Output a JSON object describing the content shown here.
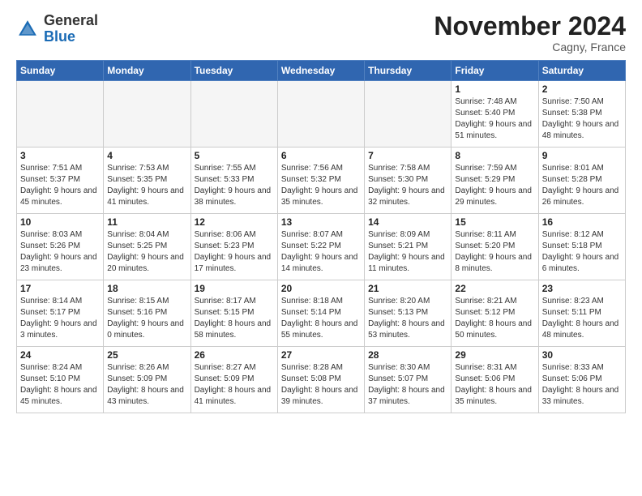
{
  "logo": {
    "general": "General",
    "blue": "Blue"
  },
  "header": {
    "title": "November 2024",
    "location": "Cagny, France"
  },
  "weekdays": [
    "Sunday",
    "Monday",
    "Tuesday",
    "Wednesday",
    "Thursday",
    "Friday",
    "Saturday"
  ],
  "weeks": [
    [
      {
        "day": "",
        "info": ""
      },
      {
        "day": "",
        "info": ""
      },
      {
        "day": "",
        "info": ""
      },
      {
        "day": "",
        "info": ""
      },
      {
        "day": "",
        "info": ""
      },
      {
        "day": "1",
        "info": "Sunrise: 7:48 AM\nSunset: 5:40 PM\nDaylight: 9 hours and 51 minutes."
      },
      {
        "day": "2",
        "info": "Sunrise: 7:50 AM\nSunset: 5:38 PM\nDaylight: 9 hours and 48 minutes."
      }
    ],
    [
      {
        "day": "3",
        "info": "Sunrise: 7:51 AM\nSunset: 5:37 PM\nDaylight: 9 hours and 45 minutes."
      },
      {
        "day": "4",
        "info": "Sunrise: 7:53 AM\nSunset: 5:35 PM\nDaylight: 9 hours and 41 minutes."
      },
      {
        "day": "5",
        "info": "Sunrise: 7:55 AM\nSunset: 5:33 PM\nDaylight: 9 hours and 38 minutes."
      },
      {
        "day": "6",
        "info": "Sunrise: 7:56 AM\nSunset: 5:32 PM\nDaylight: 9 hours and 35 minutes."
      },
      {
        "day": "7",
        "info": "Sunrise: 7:58 AM\nSunset: 5:30 PM\nDaylight: 9 hours and 32 minutes."
      },
      {
        "day": "8",
        "info": "Sunrise: 7:59 AM\nSunset: 5:29 PM\nDaylight: 9 hours and 29 minutes."
      },
      {
        "day": "9",
        "info": "Sunrise: 8:01 AM\nSunset: 5:28 PM\nDaylight: 9 hours and 26 minutes."
      }
    ],
    [
      {
        "day": "10",
        "info": "Sunrise: 8:03 AM\nSunset: 5:26 PM\nDaylight: 9 hours and 23 minutes."
      },
      {
        "day": "11",
        "info": "Sunrise: 8:04 AM\nSunset: 5:25 PM\nDaylight: 9 hours and 20 minutes."
      },
      {
        "day": "12",
        "info": "Sunrise: 8:06 AM\nSunset: 5:23 PM\nDaylight: 9 hours and 17 minutes."
      },
      {
        "day": "13",
        "info": "Sunrise: 8:07 AM\nSunset: 5:22 PM\nDaylight: 9 hours and 14 minutes."
      },
      {
        "day": "14",
        "info": "Sunrise: 8:09 AM\nSunset: 5:21 PM\nDaylight: 9 hours and 11 minutes."
      },
      {
        "day": "15",
        "info": "Sunrise: 8:11 AM\nSunset: 5:20 PM\nDaylight: 9 hours and 8 minutes."
      },
      {
        "day": "16",
        "info": "Sunrise: 8:12 AM\nSunset: 5:18 PM\nDaylight: 9 hours and 6 minutes."
      }
    ],
    [
      {
        "day": "17",
        "info": "Sunrise: 8:14 AM\nSunset: 5:17 PM\nDaylight: 9 hours and 3 minutes."
      },
      {
        "day": "18",
        "info": "Sunrise: 8:15 AM\nSunset: 5:16 PM\nDaylight: 9 hours and 0 minutes."
      },
      {
        "day": "19",
        "info": "Sunrise: 8:17 AM\nSunset: 5:15 PM\nDaylight: 8 hours and 58 minutes."
      },
      {
        "day": "20",
        "info": "Sunrise: 8:18 AM\nSunset: 5:14 PM\nDaylight: 8 hours and 55 minutes."
      },
      {
        "day": "21",
        "info": "Sunrise: 8:20 AM\nSunset: 5:13 PM\nDaylight: 8 hours and 53 minutes."
      },
      {
        "day": "22",
        "info": "Sunrise: 8:21 AM\nSunset: 5:12 PM\nDaylight: 8 hours and 50 minutes."
      },
      {
        "day": "23",
        "info": "Sunrise: 8:23 AM\nSunset: 5:11 PM\nDaylight: 8 hours and 48 minutes."
      }
    ],
    [
      {
        "day": "24",
        "info": "Sunrise: 8:24 AM\nSunset: 5:10 PM\nDaylight: 8 hours and 45 minutes."
      },
      {
        "day": "25",
        "info": "Sunrise: 8:26 AM\nSunset: 5:09 PM\nDaylight: 8 hours and 43 minutes."
      },
      {
        "day": "26",
        "info": "Sunrise: 8:27 AM\nSunset: 5:09 PM\nDaylight: 8 hours and 41 minutes."
      },
      {
        "day": "27",
        "info": "Sunrise: 8:28 AM\nSunset: 5:08 PM\nDaylight: 8 hours and 39 minutes."
      },
      {
        "day": "28",
        "info": "Sunrise: 8:30 AM\nSunset: 5:07 PM\nDaylight: 8 hours and 37 minutes."
      },
      {
        "day": "29",
        "info": "Sunrise: 8:31 AM\nSunset: 5:06 PM\nDaylight: 8 hours and 35 minutes."
      },
      {
        "day": "30",
        "info": "Sunrise: 8:33 AM\nSunset: 5:06 PM\nDaylight: 8 hours and 33 minutes."
      }
    ]
  ]
}
